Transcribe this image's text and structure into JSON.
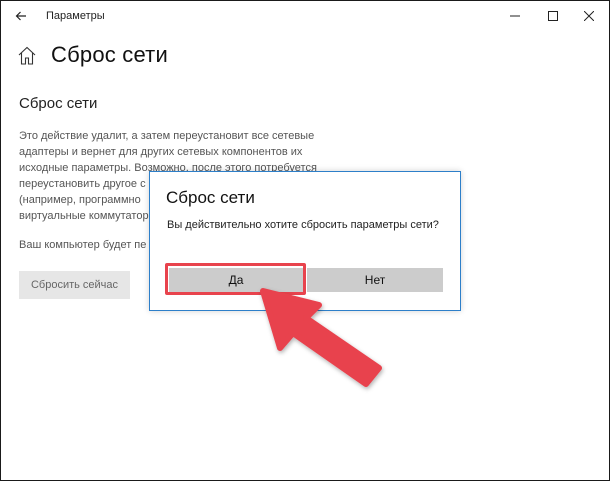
{
  "window": {
    "title": "Параметры"
  },
  "page": {
    "title": "Сброс сети",
    "section_title": "Сброс сети",
    "description": "Это действие удалит, а затем переустановит все сетевые\nадаптеры и вернет для других сетевых компонентов их\nисходные параметры. Возможно, после этого потребуется\nпереустановить другое с\n(например, программно\nвиртуальные коммутатор",
    "warning": "Ваш компьютер будет пе",
    "reset_button": "Сбросить сейчас"
  },
  "dialog": {
    "title": "Сброс сети",
    "message": "Вы действительно хотите сбросить параметры сети?",
    "yes_label": "Да",
    "no_label": "Нет"
  },
  "icons": {
    "back": "back-arrow-icon",
    "home": "home-icon",
    "minimize": "minimize-icon",
    "maximize": "maximize-icon",
    "close": "close-icon"
  },
  "colors": {
    "dialog_border": "#2d7fc9",
    "highlight": "#e8434d",
    "button_gray": "#cccccc"
  }
}
